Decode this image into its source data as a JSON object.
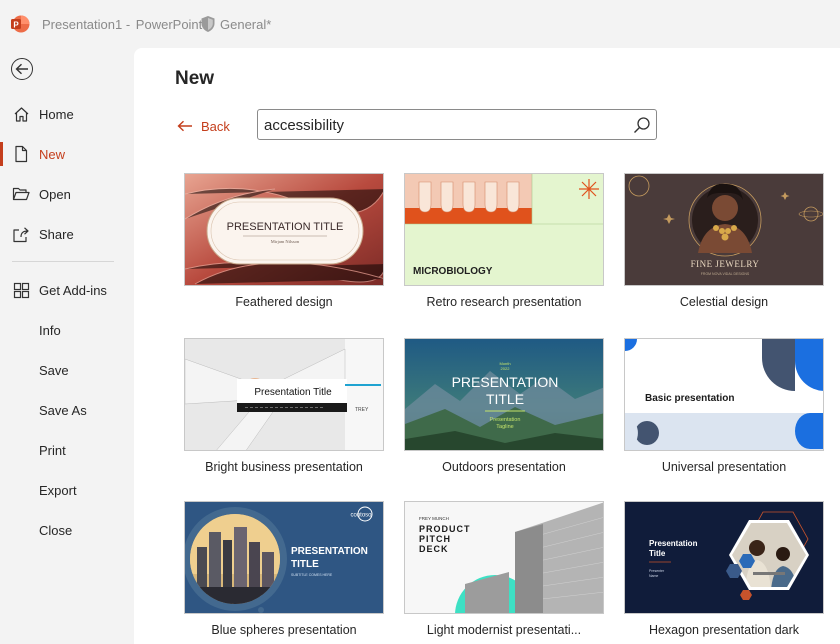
{
  "titlebar": {
    "doc_name": "Presentation1",
    "separator": " - ",
    "app_name": "PowerPoint",
    "sensitivity": "General*"
  },
  "sidebar": {
    "items": [
      {
        "label": "Home",
        "icon": "home-icon"
      },
      {
        "label": "New",
        "icon": "new-doc-icon",
        "active": true
      },
      {
        "label": "Open",
        "icon": "folder-open-icon"
      },
      {
        "label": "Share",
        "icon": "share-icon"
      },
      {
        "label": "Get Add-ins",
        "icon": "add-ins-icon"
      },
      {
        "label": "Info"
      },
      {
        "label": "Save"
      },
      {
        "label": "Save As"
      },
      {
        "label": "Print"
      },
      {
        "label": "Export"
      },
      {
        "label": "Close"
      }
    ]
  },
  "main": {
    "title": "New",
    "back_label": "Back",
    "search_value": "accessibility",
    "templates": [
      {
        "name": "Feathered design",
        "thumb_title": "PRESENTATION TITLE",
        "thumb_sub": "Mirjam Nilsson"
      },
      {
        "name": "Retro research presentation",
        "thumb_title": "MICROBIOLOGY"
      },
      {
        "name": "Celestial design",
        "thumb_title": "FINE JEWELRY",
        "thumb_sub": "FROM NOVA VIDAL DESIGNS"
      },
      {
        "name": "Bright business presentation",
        "thumb_title": "Presentation Title",
        "thumb_sub": "TREY"
      },
      {
        "name": "Outdoors presentation",
        "thumb_title_1": "PRESENTATION",
        "thumb_title_2": "TITLE",
        "thumb_top_1": "Month",
        "thumb_top_2": "2022",
        "thumb_sub_1": "Presentation",
        "thumb_sub_2": "Tagline"
      },
      {
        "name": "Universal presentation",
        "thumb_title": "Basic presentation"
      },
      {
        "name": "Blue spheres presentation",
        "thumb_title_1": "PRESENTATION",
        "thumb_title_2": "TITLE",
        "thumb_brand": "contoso",
        "thumb_sub": "SUBTITLE COMES HERE"
      },
      {
        "name": "Light modernist presentati...",
        "thumb_top": "FREY MUNCH",
        "thumb_title_1": "PRODUCT",
        "thumb_title_2": "PITCH",
        "thumb_title_3": "DECK"
      },
      {
        "name": "Hexagon presentation dark",
        "thumb_title_1": "Presentation",
        "thumb_title_2": "Title",
        "thumb_sub_1": "Presenter",
        "thumb_sub_2": "Name"
      }
    ]
  },
  "colors": {
    "accent": "#c43e1c",
    "sidebar_bg": "#f3f3f3",
    "main_bg": "#ffffff"
  }
}
